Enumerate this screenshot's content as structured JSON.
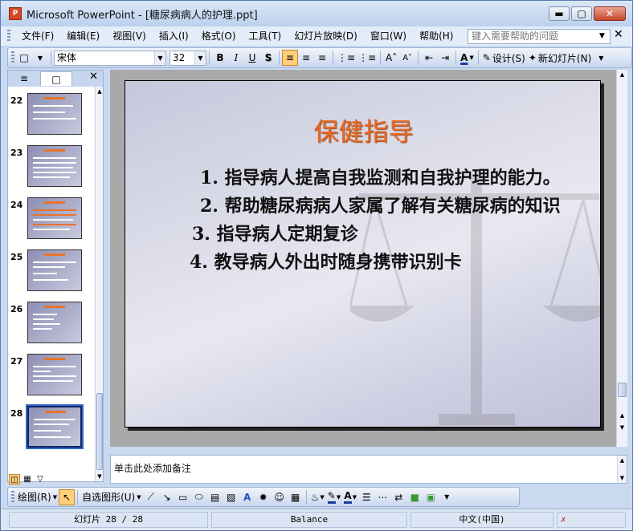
{
  "window": {
    "title": "Microsoft PowerPoint - [糖尿病病人的护理.ppt]",
    "app_icon_text": "P"
  },
  "menubar": {
    "items": [
      {
        "label": "文件(F)"
      },
      {
        "label": "编辑(E)"
      },
      {
        "label": "视图(V)"
      },
      {
        "label": "插入(I)"
      },
      {
        "label": "格式(O)"
      },
      {
        "label": "工具(T)"
      },
      {
        "label": "幻灯片放映(D)"
      },
      {
        "label": "窗口(W)"
      },
      {
        "label": "帮助(H)"
      }
    ],
    "help_placeholder": "键入需要帮助的问题"
  },
  "toolbar": {
    "font_name": "宋体",
    "font_size": "32",
    "bold": "B",
    "italic": "I",
    "underline": "U",
    "design_label": "设计(S)",
    "new_slide_label": "新幻灯片(N)"
  },
  "thumbnails": [
    {
      "num": "22"
    },
    {
      "num": "23"
    },
    {
      "num": "24"
    },
    {
      "num": "25"
    },
    {
      "num": "26"
    },
    {
      "num": "27"
    },
    {
      "num": "28"
    }
  ],
  "slide": {
    "title": "保健指导",
    "items": [
      {
        "num": "1.",
        "text": "指导病人提高自我监测和自我护理的能力。"
      },
      {
        "num": "2.",
        "text": "帮助糖尿病病人家属了解有关糖尿病的知识"
      },
      {
        "num": "3.",
        "text": "指导病人定期复诊"
      },
      {
        "num": "4.",
        "text": "教导病人外出时随身携带识别卡"
      }
    ]
  },
  "notes": {
    "placeholder": "单击此处添加备注"
  },
  "drawbar": {
    "draw_label": "绘图(R)",
    "autoshapes_label": "自选图形(U)"
  },
  "status": {
    "slide_position": "幻灯片 28 / 28",
    "design": "Balance",
    "language": "中文(中国)"
  }
}
